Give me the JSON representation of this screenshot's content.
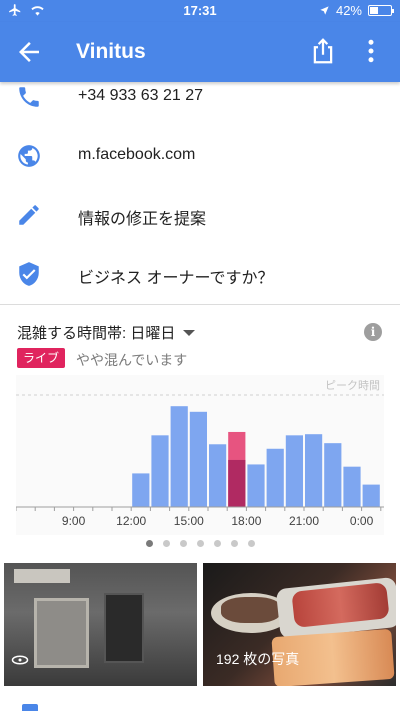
{
  "status_bar": {
    "time": "17:31",
    "battery": "42%",
    "battery_level": 0.42
  },
  "app_bar": {
    "title": "Vinitus",
    "back_icon": "arrow-back-icon",
    "share_icon": "share-icon",
    "more_icon": "more-vert-icon"
  },
  "details": [
    {
      "icon": "phone-icon",
      "text": "+34 933 63 21 27"
    },
    {
      "icon": "globe-icon",
      "text": "m.facebook.com"
    },
    {
      "icon": "edit-icon",
      "text": "情報の修正を提案"
    },
    {
      "icon": "verified-shield-icon",
      "text": "ビジネス オーナーですか？"
    }
  ],
  "popular_times": {
    "title": "混雑する時間帯: 日曜日",
    "info_icon": "info-icon",
    "live_badge": "ライブ",
    "live_status": "やや混んでいます",
    "peak_label": "ピーク時間"
  },
  "chart_data": {
    "type": "bar",
    "categories": [
      "6",
      "7",
      "8",
      "9",
      "10",
      "11",
      "12",
      "13",
      "14",
      "15",
      "16",
      "17",
      "18",
      "19",
      "20",
      "21",
      "22",
      "23",
      "0",
      "1"
    ],
    "x_tick_labels": [
      "9:00",
      "12:00",
      "15:00",
      "18:00",
      "21:00",
      "0:00"
    ],
    "series": [
      {
        "values": [
          0,
          0,
          0,
          0,
          0,
          0,
          30,
          64,
          90,
          85,
          56,
          42,
          38,
          52,
          64,
          65,
          57,
          36,
          20,
          0
        ]
      }
    ],
    "live_value": 67,
    "live_index": 11,
    "ylim": [
      0,
      100
    ],
    "colors": {
      "bar": "#7ea6f0",
      "live": "#e75480",
      "live_dark": "#b02a62"
    }
  },
  "carousel": {
    "count": 7,
    "active": 0
  },
  "photos": [
    {
      "label": ""
    },
    {
      "label": "192 枚の写真",
      "icon": "photos-icon"
    }
  ],
  "colors": {
    "brand": "#4a86e8",
    "live": "#e0245e"
  }
}
